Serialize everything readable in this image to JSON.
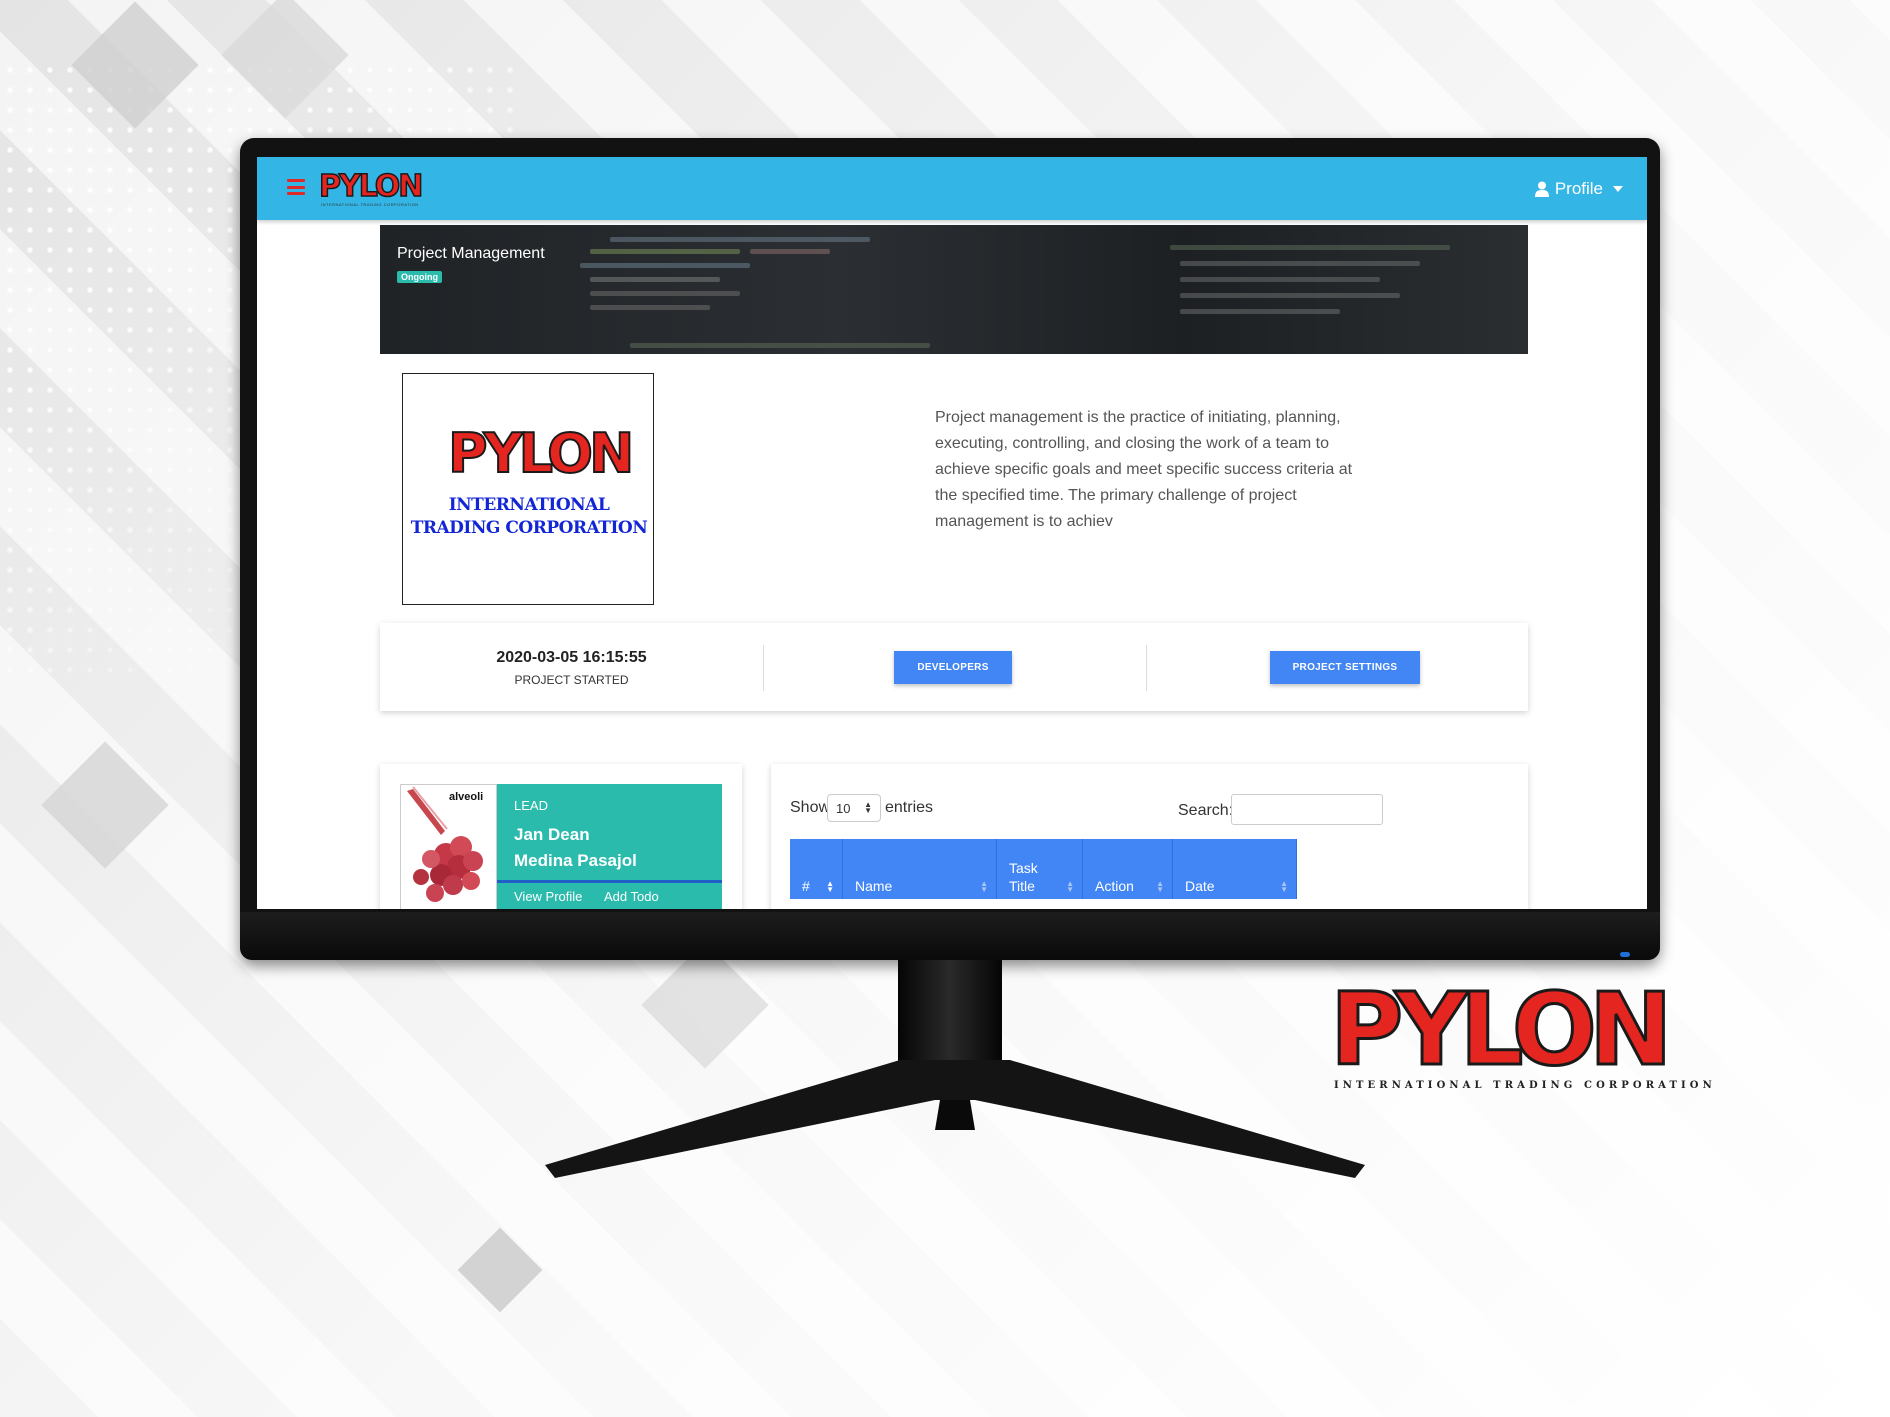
{
  "brand": {
    "logo_text": "PYLON",
    "tagline": "INTERNATIONAL TRADING CORPORATION",
    "logo_caption": "INTERNATIONAL TRADING CORPORATION",
    "red": "#e42520",
    "caption_blue": "#1226d6"
  },
  "navbar": {
    "menu_icon": "hamburger-icon",
    "profile_label": "Profile",
    "profile_icon": "user-icon",
    "bg_color": "#33b5e5"
  },
  "banner": {
    "title": "Project Management",
    "status_badge": "Ongoing"
  },
  "project": {
    "description": "Project management is the practice of initiating, planning, executing, controlling, and closing the work of a team to achieve specific goals and meet specific success criteria at the specified time. The primary challenge of project management is to achiev",
    "started_at": "2020-03-05 16:15:55",
    "started_label": "PROJECT STARTED",
    "developers_button": "DEVELOPERS",
    "settings_button": "PROJECT SETTINGS"
  },
  "lead": {
    "image_label": "alveoli",
    "role": "LEAD",
    "name_line1": "Jan Dean",
    "name_line2": "Medina Pasajol",
    "view_profile": "View Profile",
    "add_todo": "Add Todo",
    "card_color": "#2bbbad"
  },
  "table": {
    "show_label": "Show",
    "entries_value": "10",
    "entries_label": "entries",
    "search_label": "Search:",
    "columns": [
      "#",
      "Name",
      "Task Title",
      "Action",
      "Date"
    ],
    "header_color": "#4285f4"
  }
}
